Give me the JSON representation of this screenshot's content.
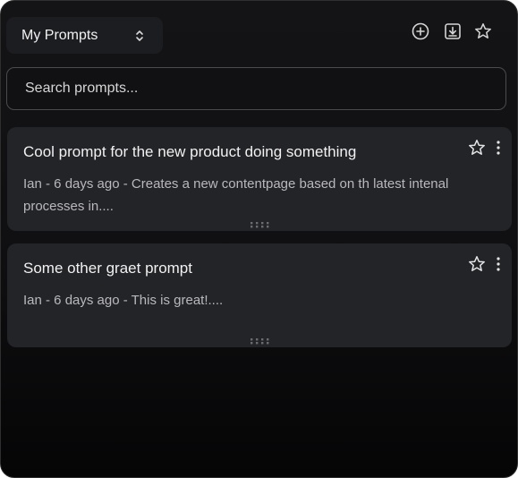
{
  "header": {
    "dropdown": {
      "selected": "My Prompts",
      "icon": "chevron-up-down-icon"
    },
    "actions": [
      {
        "name": "add-prompt-button",
        "icon": "plus-circle-icon"
      },
      {
        "name": "import-button",
        "icon": "download-icon"
      },
      {
        "name": "favorites-button",
        "icon": "star-icon"
      }
    ]
  },
  "search": {
    "placeholder": "Search prompts...",
    "value": ""
  },
  "prompts": [
    {
      "title": "Cool prompt for the new product doing something",
      "meta": "Ian - 6 days ago - Creates a new contentpage based on th latest intenal processes in....",
      "favorite_icon": "star-outline-icon",
      "menu_icon": "more-vertical-icon",
      "handle_icon": "drag-handle-icon"
    },
    {
      "title": "Some other graet prompt",
      "meta": "Ian - 6 days ago - This is great!....",
      "favorite_icon": "star-outline-icon",
      "menu_icon": "more-vertical-icon",
      "handle_icon": "drag-handle-icon"
    }
  ],
  "colors": {
    "background": "#141416",
    "card": "#232428",
    "dropdown": "#1c1d21",
    "border": "#4a4b50",
    "text": "#f1f1f1",
    "muted_text": "#b9b9bd"
  }
}
